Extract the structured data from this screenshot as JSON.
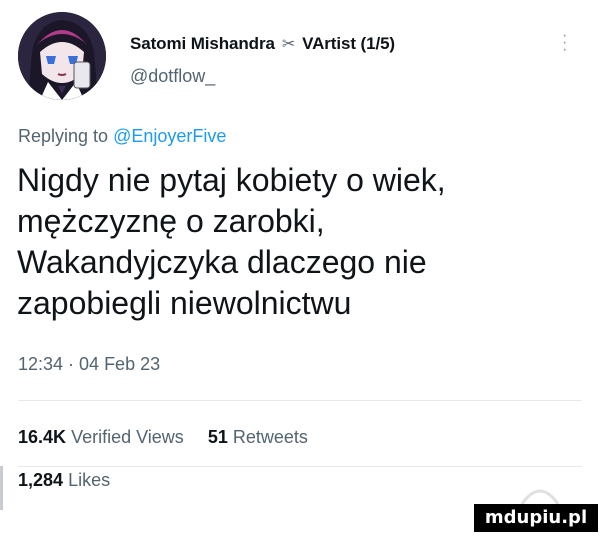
{
  "tweet": {
    "author": {
      "name": "Satomi Mishandra",
      "tag": "VArtist (1/5)",
      "handle": "@dotflow_",
      "scissors_icon": "scissors-icon",
      "avatar_icon": "anime-avatar"
    },
    "reply": {
      "prefix": "Replying to ",
      "mention": "@EnjoyerFive"
    },
    "text_lines": [
      "Nigdy nie pytaj kobiety o wiek,",
      "mężczyznę o zarobki,",
      "Wakandyjczyka dlaczego nie",
      "zapobiegli niewolnictwu"
    ],
    "timestamp": "12:34 · 04 Feb 23",
    "stats": {
      "views_count": "16.4K",
      "views_label": "Verified Views",
      "retweets_count": "51",
      "retweets_label": "Retweets",
      "likes_count": "1,284",
      "likes_label": "Likes"
    },
    "more_icon": "more-vertical-icon"
  },
  "watermark": {
    "text": "mdupiu.pl"
  },
  "colors": {
    "text": "#0f1419",
    "secondary": "#536471",
    "link": "#1d9bf0",
    "divider": "#e7e9ea"
  }
}
